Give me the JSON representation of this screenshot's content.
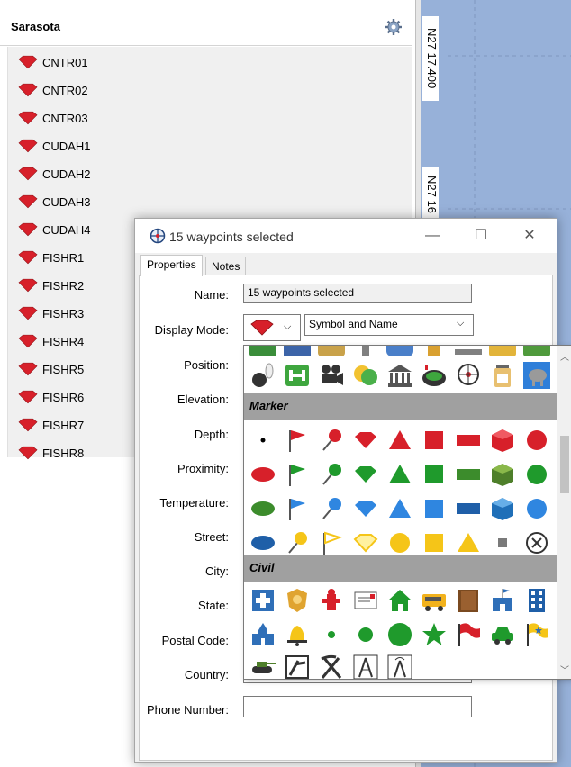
{
  "left_panel": {
    "title": "Sarasota",
    "gear_icon": "gear-icon",
    "waypoints": [
      "CNTR01",
      "CNTR02",
      "CNTR03",
      "CUDAH1",
      "CUDAH2",
      "CUDAH3",
      "CUDAH4",
      "FISHR1",
      "FISHR2",
      "FISHR3",
      "FISHR4",
      "FISHR5",
      "FISHR6",
      "FISHR7",
      "FISHR8"
    ]
  },
  "map": {
    "coord_top": "N27 17.400",
    "coord_second": "N27 16"
  },
  "dialog": {
    "title": "15 waypoints selected",
    "minimize": "—",
    "maximize": "☐",
    "close": "✕",
    "tabs": [
      "Properties",
      "Notes"
    ],
    "fields": {
      "name_label": "Name:",
      "name_value": "15 waypoints selected",
      "display_mode_label": "Display Mode:",
      "display_mode_value": "Symbol and Name",
      "position_label": "Position:",
      "elevation_label": "Elevation:",
      "depth_label": "Depth:",
      "proximity_label": "Proximity:",
      "temperature_label": "Temperature:",
      "street_label": "Street:",
      "city_label": "City:",
      "state_label": "State:",
      "postal_code_label": "Postal Code:",
      "country_label": "Country:",
      "phone_label": "Phone Number:"
    }
  },
  "symbol_picker": {
    "categories": [
      "Marker",
      "Civil"
    ]
  },
  "colors": {
    "gem_red": "#d7202a",
    "map_blue": "#97b1d9",
    "category_bg": "#a0a0a0"
  }
}
